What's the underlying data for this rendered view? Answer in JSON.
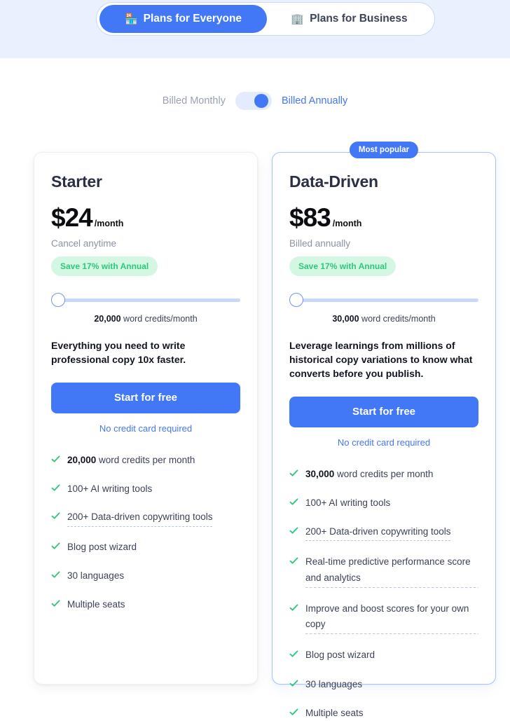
{
  "header": {
    "tabs": [
      {
        "label": "Plans for Everyone",
        "icon": "storefront-icon",
        "glyph": "🏪",
        "active": true
      },
      {
        "label": "Plans for Business",
        "icon": "office-building-icon",
        "glyph": "🏢",
        "active": false
      }
    ]
  },
  "billing": {
    "monthly_label": "Billed Monthly",
    "annual_label": "Billed Annually",
    "selected": "annual"
  },
  "plans": [
    {
      "name": "Starter",
      "price": "$24",
      "period": "/month",
      "billing_note": "Cancel anytime",
      "save_badge": "Save 17% with Annual",
      "slider": {
        "credits": "20,000",
        "credits_suffix": " word credits/month",
        "position_percent": 0
      },
      "description": "Everything you need to write professional copy 10x faster.",
      "cta_label": "Start for free",
      "cta_subtext": "No credit card required",
      "features": [
        {
          "bold": "20,000",
          "text": " word credits per month",
          "tooltip": false
        },
        {
          "bold": "",
          "text": "100+ AI writing tools",
          "tooltip": false
        },
        {
          "bold": "",
          "text": "200+ Data-driven copywriting tools",
          "tooltip": true
        },
        {
          "bold": "",
          "text": "Blog post wizard",
          "tooltip": false
        },
        {
          "bold": "",
          "text": "30 languages",
          "tooltip": false
        },
        {
          "bold": "",
          "text": "Multiple seats",
          "tooltip": false
        }
      ]
    },
    {
      "name": "Data-Driven",
      "badge": "Most popular",
      "price": "$83",
      "period": "/month",
      "billing_note": "Billed annually",
      "save_badge": "Save 17% with Annual",
      "slider": {
        "credits": "30,000",
        "credits_suffix": " word credits/month",
        "position_percent": 0
      },
      "description": "Leverage learnings from millions of historical copy variations to know what converts before you publish.",
      "cta_label": "Start for free",
      "cta_subtext": "No credit card required",
      "features": [
        {
          "bold": "30,000",
          "text": " word credits per month",
          "tooltip": false
        },
        {
          "bold": "",
          "text": "100+ AI writing tools",
          "tooltip": false
        },
        {
          "bold": "",
          "text": "200+ Data-driven copywriting tools",
          "tooltip": true
        },
        {
          "bold": "",
          "text": "Real-time predictive performance score and analytics",
          "tooltip": true
        },
        {
          "bold": "",
          "text": "Improve and boost scores for your own copy",
          "tooltip": true
        },
        {
          "bold": "",
          "text": "Blog post wizard",
          "tooltip": false
        },
        {
          "bold": "",
          "text": "30 languages",
          "tooltip": false
        },
        {
          "bold": "",
          "text": "Multiple seats",
          "tooltip": false
        }
      ]
    }
  ],
  "colors": {
    "brand_blue": "#4277f5",
    "band_background": "#eaf0fd",
    "check_green": "#2fc77e",
    "save_badge_bg": "#d4f7e4"
  }
}
